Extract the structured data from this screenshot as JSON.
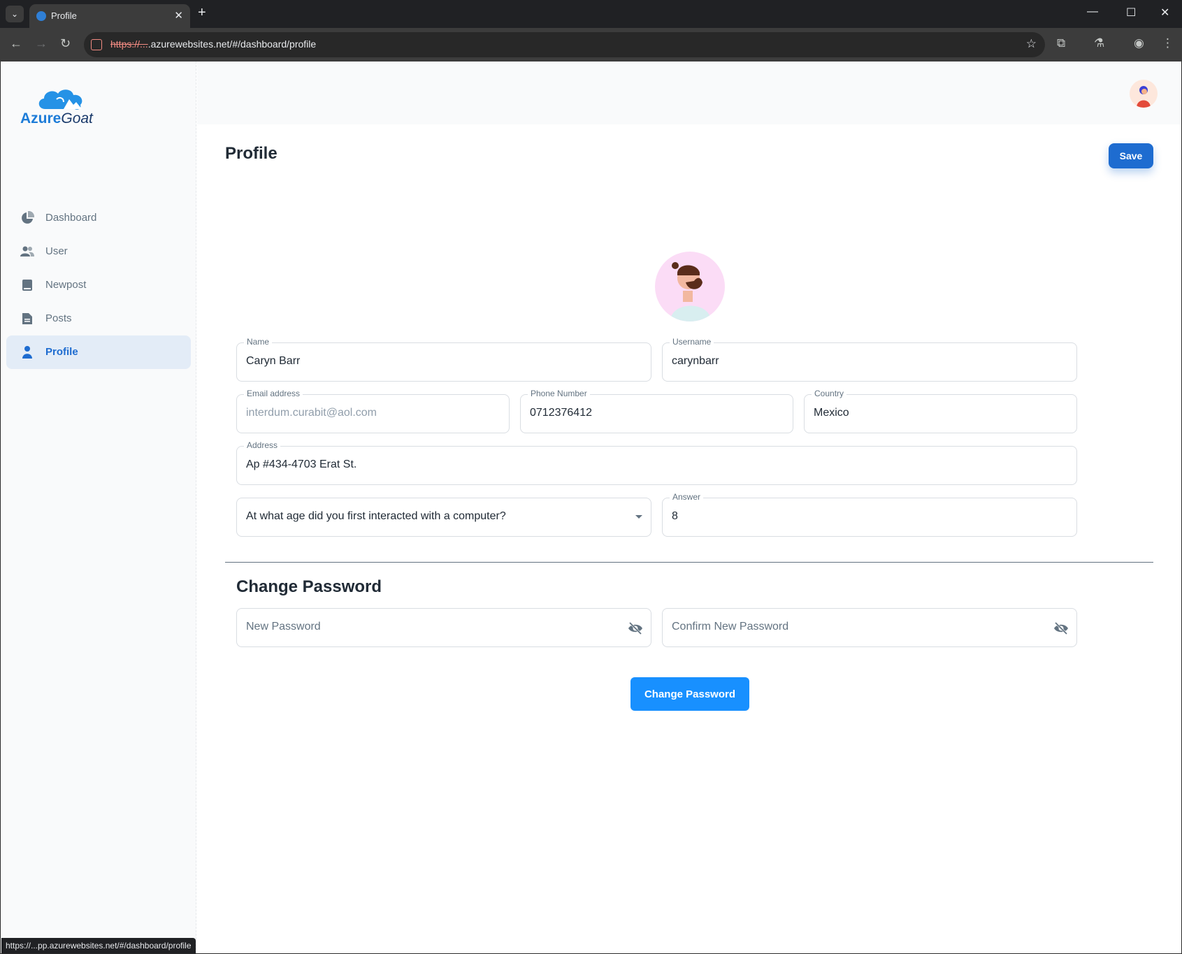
{
  "browser": {
    "tab_title": "Profile",
    "url_prefix": "https://...",
    "url": ".azurewebsites.net/#/dashboard/profile",
    "status_url": "https://...pp.azurewebsites.net/#/dashboard/profile"
  },
  "app": {
    "logo_brand": "Azure",
    "logo_suffix": "Goat",
    "accent_color": "#1e6cd0"
  },
  "sidebar": {
    "items": [
      {
        "label": "Dashboard",
        "icon": "pie-chart-icon",
        "active": false
      },
      {
        "label": "User",
        "icon": "users-icon",
        "active": false
      },
      {
        "label": "Newpost",
        "icon": "book-icon",
        "active": false
      },
      {
        "label": "Posts",
        "icon": "document-icon",
        "active": false
      },
      {
        "label": "Profile",
        "icon": "person-icon",
        "active": true
      }
    ]
  },
  "page": {
    "title": "Profile",
    "save_label": "Save"
  },
  "form": {
    "name": {
      "label": "Name",
      "value": "Caryn Barr"
    },
    "username": {
      "label": "Username",
      "value": "carynbarr"
    },
    "email": {
      "label": "Email address",
      "value": "interdum.curabit@aol.com"
    },
    "phone": {
      "label": "Phone Number",
      "value": "0712376412"
    },
    "country": {
      "label": "Country",
      "value": "Mexico"
    },
    "address": {
      "label": "Address",
      "value": "Ap #434-4703 Erat St."
    },
    "security_question": {
      "value": "At what age did you first interacted with a computer?"
    },
    "answer": {
      "label": "Answer",
      "value": "8"
    }
  },
  "password": {
    "title": "Change Password",
    "new_placeholder": "New Password",
    "confirm_placeholder": "Confirm New Password",
    "button_label": "Change Password"
  }
}
